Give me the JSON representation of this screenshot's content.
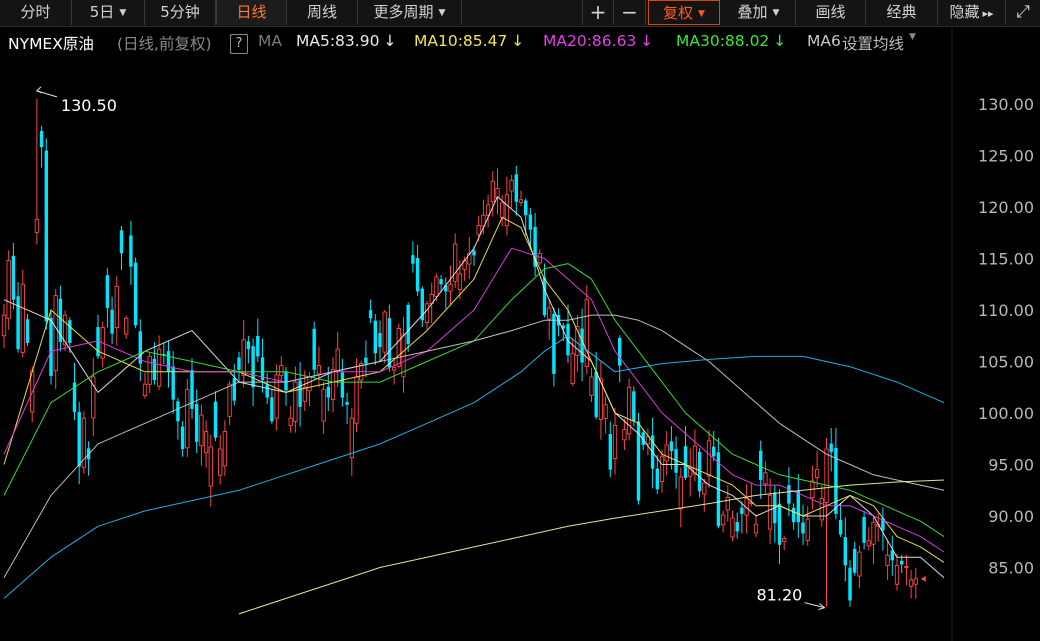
{
  "toolbar": {
    "items": [
      {
        "label": "分时"
      },
      {
        "label": "5日",
        "caret": true
      },
      {
        "label": "5分钟"
      },
      {
        "label": "日线",
        "active": true
      },
      {
        "label": "周线"
      },
      {
        "label": "更多周期",
        "caret": true
      }
    ],
    "right_items": [
      {
        "label": "+"
      },
      {
        "label": "−"
      },
      {
        "label": "复权",
        "caret": true,
        "highlight": true
      },
      {
        "label": "叠加",
        "caret": true
      },
      {
        "label": "画线"
      },
      {
        "label": "经典"
      },
      {
        "label": "隐藏",
        "suffix": "▸▸"
      },
      {
        "label": "⤢"
      }
    ]
  },
  "legend": {
    "symbol": "NYMEX原油",
    "mode": "(日线,前复权)",
    "help": "?",
    "ma_label": "MA",
    "ma5": "MA5:83.90",
    "ma10": "MA10:85.47",
    "ma20": "MA20:86.63",
    "ma30": "MA30:88.02",
    "ma60": "MA6(",
    "settings": "设置均线",
    "arrow": "↓"
  },
  "colors": {
    "up": "#ff4545",
    "down": "#00e5ff",
    "ma5": "#e8e8e8",
    "ma10": "#f2e84a",
    "ma20": "#e83ce8",
    "ma30": "#36e836",
    "ma60": "#c8c8c8",
    "ma120": "#24b8f0",
    "ma250": "#f0f0a0"
  },
  "chart_data": {
    "type": "candlestick",
    "title": "NYMEX原油",
    "ylim": [
      80.5,
      133.5
    ],
    "yticks": [
      "130.00",
      "125.00",
      "120.00",
      "115.00",
      "110.00",
      "105.00",
      "100.00",
      "95.00",
      "90.00",
      "85.00"
    ],
    "annotations": {
      "high": "130.50",
      "low": "81.20"
    },
    "closes": [
      109.5,
      114.8,
      111,
      106.2,
      112.5,
      106.8,
      104.1,
      118.8,
      125.8,
      108.9,
      103.6,
      111.4,
      106.9,
      109.5,
      106.8,
      100.1,
      94.8,
      99.5,
      95.5,
      103.5,
      105.5,
      108.3,
      110.2,
      107.7,
      112.3,
      115.5,
      109.2,
      114.2,
      108.5,
      104.8,
      102.8,
      105.5,
      103.2,
      106.2,
      105.7,
      104,
      101.3,
      99.2,
      96.5,
      102.3,
      100.4,
      97.2,
      99.8,
      98.2,
      96.7,
      97.6,
      96.5,
      98.2,
      102.8,
      101.2,
      104.2,
      107.1,
      106.2,
      102.5,
      105.5,
      103.2,
      101.5,
      99.2,
      103.7,
      104.6,
      102.2,
      99.5,
      103,
      100.6,
      102.5,
      103.5,
      104.2,
      104.6,
      102.3,
      101.5,
      104.2,
      106.2,
      101.5,
      100.8,
      99.5,
      103.5,
      104.8,
      104.8,
      109.2,
      105.8,
      106.4,
      109.8,
      104.4,
      104.4,
      108.2,
      107.6,
      106.7,
      114.5,
      111.8,
      109,
      110.6,
      111.5,
      113.2,
      112.5,
      111.8,
      112.5,
      116.4,
      113.5,
      114.8,
      115.5,
      115.3,
      118.2,
      119.2,
      120.2,
      122.5,
      121.8,
      120.4,
      121.2,
      122.6,
      120.5,
      120.7,
      119.2,
      117.8,
      114.2,
      115.5,
      109.5,
      110.2,
      103.8,
      108.5,
      108.2,
      105.6,
      105.8,
      108.4,
      104.9,
      111,
      103.5,
      99.6,
      103.3,
      100.8,
      94.5,
      98.8,
      104.6,
      98.4,
      102.5,
      99.2,
      91.5,
      96.9,
      97.7,
      94.6,
      92.6,
      95.8,
      96.9,
      96.3,
      94.2,
      93.8,
      93.7,
      94.6,
      96.8,
      92.4,
      93.2,
      97.3,
      95.8,
      89,
      90.1,
      91.8,
      89.8,
      88.5,
      90.2,
      91.7,
      91.3,
      89.2,
      93.5,
      94.2,
      92,
      89.3,
      87.2,
      87.8,
      91.2,
      89.4,
      89.4,
      88.3,
      89.7,
      93.4,
      94.5,
      91.7,
      96.5,
      96.2,
      90.2,
      88.2,
      85.2,
      81.8,
      84.5,
      86.5,
      87.4,
      87.6,
      89.4,
      89.2,
      88.6,
      86.2,
      85.7,
      85.2,
      85.3,
      85.1,
      83.8,
      83.9
    ],
    "ma_lines": [
      {
        "name": "MA5",
        "value": "83.90",
        "points": [
          [
            0,
            111
          ],
          [
            10,
            109
          ],
          [
            20,
            102
          ],
          [
            30,
            106
          ],
          [
            40,
            108
          ],
          [
            50,
            103
          ],
          [
            60,
            102
          ],
          [
            70,
            104
          ],
          [
            80,
            105
          ],
          [
            90,
            110
          ],
          [
            100,
            116
          ],
          [
            105,
            121
          ],
          [
            110,
            119
          ],
          [
            115,
            112
          ],
          [
            120,
            107
          ],
          [
            125,
            105
          ],
          [
            130,
            100
          ],
          [
            135,
            98
          ],
          [
            140,
            95
          ],
          [
            145,
            95
          ],
          [
            150,
            93
          ],
          [
            155,
            92
          ],
          [
            160,
            90
          ],
          [
            165,
            91
          ],
          [
            170,
            90
          ],
          [
            175,
            90
          ],
          [
            180,
            92
          ],
          [
            185,
            90
          ],
          [
            190,
            86
          ],
          [
            195,
            86
          ],
          [
            200,
            84
          ]
        ]
      },
      {
        "name": "MA10",
        "value": "85.47",
        "points": [
          [
            0,
            95
          ],
          [
            10,
            110
          ],
          [
            20,
            106
          ],
          [
            30,
            104
          ],
          [
            40,
            104
          ],
          [
            50,
            104
          ],
          [
            60,
            102
          ],
          [
            70,
            103
          ],
          [
            80,
            104
          ],
          [
            90,
            108
          ],
          [
            100,
            113
          ],
          [
            106,
            119
          ],
          [
            110,
            118
          ],
          [
            115,
            113
          ],
          [
            120,
            110
          ],
          [
            125,
            105
          ],
          [
            130,
            100
          ],
          [
            135,
            99
          ],
          [
            140,
            96
          ],
          [
            145,
            95
          ],
          [
            150,
            94
          ],
          [
            155,
            93
          ],
          [
            160,
            91
          ],
          [
            165,
            91
          ],
          [
            170,
            90
          ],
          [
            175,
            91
          ],
          [
            180,
            92
          ],
          [
            185,
            91
          ],
          [
            190,
            88
          ],
          [
            195,
            87
          ],
          [
            200,
            85.5
          ]
        ]
      },
      {
        "name": "MA20",
        "value": "86.63",
        "points": [
          [
            0,
            96
          ],
          [
            10,
            106
          ],
          [
            20,
            107
          ],
          [
            30,
            105
          ],
          [
            40,
            104
          ],
          [
            50,
            104
          ],
          [
            60,
            103
          ],
          [
            70,
            104
          ],
          [
            80,
            104
          ],
          [
            90,
            106
          ],
          [
            100,
            110
          ],
          [
            108,
            116
          ],
          [
            115,
            115
          ],
          [
            120,
            113
          ],
          [
            125,
            111
          ],
          [
            130,
            106
          ],
          [
            135,
            103
          ],
          [
            140,
            100
          ],
          [
            145,
            98
          ],
          [
            150,
            96
          ],
          [
            155,
            94
          ],
          [
            160,
            93
          ],
          [
            165,
            93
          ],
          [
            170,
            92
          ],
          [
            175,
            91
          ],
          [
            180,
            91
          ],
          [
            185,
            90
          ],
          [
            190,
            89
          ],
          [
            195,
            88
          ],
          [
            200,
            86.5
          ]
        ]
      },
      {
        "name": "MA30",
        "value": "88.02",
        "points": [
          [
            0,
            92
          ],
          [
            10,
            101
          ],
          [
            20,
            104
          ],
          [
            30,
            106
          ],
          [
            40,
            105
          ],
          [
            50,
            104
          ],
          [
            60,
            104
          ],
          [
            70,
            103
          ],
          [
            80,
            103
          ],
          [
            90,
            105
          ],
          [
            100,
            107
          ],
          [
            108,
            111
          ],
          [
            115,
            114
          ],
          [
            120,
            114.5
          ],
          [
            125,
            113
          ],
          [
            130,
            109
          ],
          [
            135,
            106
          ],
          [
            140,
            103
          ],
          [
            145,
            100
          ],
          [
            150,
            98
          ],
          [
            155,
            96
          ],
          [
            160,
            95
          ],
          [
            165,
            94
          ],
          [
            170,
            93.5
          ],
          [
            175,
            93
          ],
          [
            180,
            92.5
          ],
          [
            185,
            91.5
          ],
          [
            190,
            90.5
          ],
          [
            195,
            89.5
          ],
          [
            200,
            88
          ]
        ]
      },
      {
        "name": "MA60",
        "value": "",
        "points": [
          [
            0,
            84
          ],
          [
            10,
            92
          ],
          [
            20,
            97
          ],
          [
            30,
            99
          ],
          [
            40,
            101
          ],
          [
            50,
            103
          ],
          [
            60,
            103
          ],
          [
            70,
            104
          ],
          [
            80,
            105
          ],
          [
            90,
            106
          ],
          [
            100,
            107
          ],
          [
            108,
            108
          ],
          [
            115,
            109
          ],
          [
            120,
            109
          ],
          [
            125,
            109.5
          ],
          [
            130,
            109.5
          ],
          [
            135,
            109
          ],
          [
            140,
            108
          ],
          [
            145,
            106.5
          ],
          [
            150,
            105
          ],
          [
            155,
            103
          ],
          [
            160,
            101
          ],
          [
            165,
            99
          ],
          [
            170,
            97.5
          ],
          [
            175,
            96
          ],
          [
            180,
            95
          ],
          [
            185,
            94
          ],
          [
            190,
            93.5
          ],
          [
            195,
            93
          ],
          [
            200,
            92.5
          ]
        ]
      },
      {
        "name": "MA120",
        "value": "",
        "points": [
          [
            0,
            82
          ],
          [
            10,
            86
          ],
          [
            20,
            89
          ],
          [
            30,
            90.5
          ],
          [
            40,
            91.5
          ],
          [
            50,
            92.5
          ],
          [
            60,
            94
          ],
          [
            70,
            95.5
          ],
          [
            80,
            97
          ],
          [
            90,
            99
          ],
          [
            100,
            101
          ],
          [
            110,
            104
          ],
          [
            115,
            106
          ],
          [
            120,
            107.5
          ],
          [
            130,
            104
          ],
          [
            140,
            104.8
          ],
          [
            150,
            105.2
          ],
          [
            160,
            105.5
          ],
          [
            170,
            105.5
          ],
          [
            180,
            104.5
          ],
          [
            190,
            103
          ],
          [
            200,
            101
          ]
        ]
      },
      {
        "name": "MA250",
        "value": "",
        "points": [
          [
            50,
            80.5
          ],
          [
            60,
            82
          ],
          [
            70,
            83.5
          ],
          [
            80,
            85
          ],
          [
            90,
            86
          ],
          [
            100,
            87
          ],
          [
            110,
            88
          ],
          [
            120,
            89
          ],
          [
            130,
            89.8
          ],
          [
            140,
            90.5
          ],
          [
            150,
            91.2
          ],
          [
            160,
            92
          ],
          [
            170,
            92.5
          ],
          [
            180,
            93
          ],
          [
            190,
            93.3
          ],
          [
            200,
            93.5
          ]
        ]
      }
    ]
  }
}
